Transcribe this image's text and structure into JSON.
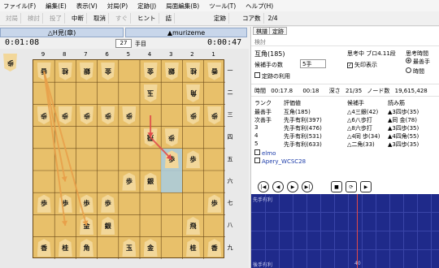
{
  "menu": [
    "ファイル(F)",
    "編集(E)",
    "表示(V)",
    "対局(P)",
    "定跡(J)",
    "局面編集(B)",
    "ツール(T)",
    "ヘルプ(H)"
  ],
  "toolbar": {
    "items": [
      {
        "label": "対局",
        "enabled": false
      },
      {
        "label": "検討",
        "enabled": false
      },
      {
        "label": "投了",
        "enabled": false
      },
      {
        "label": "中断",
        "enabled": true
      },
      {
        "label": "取消",
        "enabled": true
      },
      {
        "label": "すぐ",
        "enabled": false
      },
      {
        "label": "ヒント",
        "enabled": true
      },
      {
        "label": "詰",
        "enabled": true
      },
      {
        "label": "定跡",
        "enabled": true
      },
      {
        "label": "コア数",
        "enabled": true
      }
    ],
    "core_count": "2/4"
  },
  "players": {
    "gote_name": "△H見(章)",
    "sente_name": "▲murizeme",
    "gote_time": "0:01:08",
    "sente_time": "0:00:47",
    "move_number": "27",
    "move_suffix": "手目"
  },
  "board": {
    "files": [
      "9",
      "8",
      "7",
      "6",
      "5",
      "4",
      "3",
      "2",
      "1"
    ],
    "ranks": [
      "一",
      "二",
      "三",
      "四",
      "五",
      "六",
      "七",
      "八",
      "九"
    ],
    "gote_hand": "歩",
    "pieces": [
      {
        "f": 9,
        "r": 1,
        "p": "香",
        "g": true
      },
      {
        "f": 8,
        "r": 1,
        "p": "桂",
        "g": true
      },
      {
        "f": 7,
        "r": 1,
        "p": "銀",
        "g": true
      },
      {
        "f": 6,
        "r": 1,
        "p": "金",
        "g": true
      },
      {
        "f": 4,
        "r": 1,
        "p": "金",
        "g": true
      },
      {
        "f": 3,
        "r": 1,
        "p": "銀",
        "g": true
      },
      {
        "f": 2,
        "r": 1,
        "p": "桂",
        "g": true
      },
      {
        "f": 1,
        "r": 1,
        "p": "香",
        "g": true
      },
      {
        "f": 4,
        "r": 2,
        "p": "玉",
        "g": true
      },
      {
        "f": 2,
        "r": 2,
        "p": "角",
        "g": true
      },
      {
        "f": 9,
        "r": 3,
        "p": "歩",
        "g": true
      },
      {
        "f": 8,
        "r": 3,
        "p": "歩",
        "g": true
      },
      {
        "f": 7,
        "r": 3,
        "p": "歩",
        "g": true
      },
      {
        "f": 6,
        "r": 3,
        "p": "歩",
        "g": true
      },
      {
        "f": 5,
        "r": 3,
        "p": "歩",
        "g": true
      },
      {
        "f": 2,
        "r": 3,
        "p": "歩",
        "g": true
      },
      {
        "f": 1,
        "r": 3,
        "p": "歩",
        "g": true
      },
      {
        "f": 3,
        "r": 4,
        "p": "歩",
        "g": true
      },
      {
        "f": 4,
        "r": 4,
        "p": "飛",
        "g": true
      },
      {
        "f": 2,
        "r": 5,
        "p": "歩",
        "g": false
      },
      {
        "f": 3,
        "r": 5,
        "p": "歩",
        "g": false
      },
      {
        "f": 4,
        "r": 6,
        "p": "銀",
        "g": false
      },
      {
        "f": 5,
        "r": 6,
        "p": "歩",
        "g": false
      },
      {
        "f": 9,
        "r": 7,
        "p": "歩",
        "g": false
      },
      {
        "f": 8,
        "r": 7,
        "p": "歩",
        "g": false
      },
      {
        "f": 7,
        "r": 7,
        "p": "歩",
        "g": false
      },
      {
        "f": 6,
        "r": 7,
        "p": "歩",
        "g": false
      },
      {
        "f": 1,
        "r": 7,
        "p": "歩",
        "g": false
      },
      {
        "f": 7,
        "r": 8,
        "p": "金",
        "g": false
      },
      {
        "f": 6,
        "r": 8,
        "p": "銀",
        "g": false
      },
      {
        "f": 2,
        "r": 8,
        "p": "飛",
        "g": false
      },
      {
        "f": 9,
        "r": 9,
        "p": "香",
        "g": false
      },
      {
        "f": 8,
        "r": 9,
        "p": "桂",
        "g": false
      },
      {
        "f": 7,
        "r": 9,
        "p": "角",
        "g": false
      },
      {
        "f": 5,
        "r": 9,
        "p": "玉",
        "g": false
      },
      {
        "f": 4,
        "r": 9,
        "p": "金",
        "g": false
      },
      {
        "f": 2,
        "r": 9,
        "p": "桂",
        "g": false
      },
      {
        "f": 1,
        "r": 9,
        "p": "香",
        "g": false
      }
    ]
  },
  "panel": {
    "tabs": [
      "棋譜",
      "定跡"
    ],
    "section": "検討",
    "evaluation": "互角(185)",
    "thinking_engine": "思考中 ブロ4.11段",
    "candidate_label": "候補手の数",
    "candidate_count": "5手",
    "show_arrows": "矢印表示",
    "use_book": "定跡の利用",
    "think_time_label": "思考時間",
    "opt_best": "最善手",
    "opt_time": "時間",
    "stats": {
      "time_label": "時間",
      "time1": "00:17.8",
      "time2": "00:18",
      "depth_label": "深さ",
      "depth": "21/35",
      "nodes_label": "ノード数",
      "nodes": "19,615,428"
    },
    "table_headers": [
      "ランク",
      "評価値",
      "候補手",
      "読み筋"
    ],
    "table_rows": [
      [
        "最善手",
        "互角(185)",
        "△4三銀(42)",
        "▲3四歩(35)"
      ],
      [
        "次善手",
        "先手有利(397)",
        "△6八歩打",
        "▲同 金(78)"
      ],
      [
        "3",
        "先手有利(476)",
        "△8六歩打",
        "▲3四歩(35)"
      ],
      [
        "4",
        "先手有利(531)",
        "△4同 歩(34)",
        "▲4四角(55)"
      ],
      [
        "5",
        "先手有利(633)",
        "△二角(33)",
        "▲3四歩(35)"
      ]
    ],
    "engines": [
      "elmo",
      "Apery_WCSC28"
    ],
    "graph_top_label": "先手有利",
    "graph_bottom_label": "後手有利",
    "graph_x_marker": "40"
  },
  "colors": {
    "board": "#e8c06a",
    "highlight": "#a8cde0",
    "graph_bg": "#1f2a8a",
    "arrow_red": "#e04a4a",
    "arrow_orange": "#e8a04a"
  }
}
